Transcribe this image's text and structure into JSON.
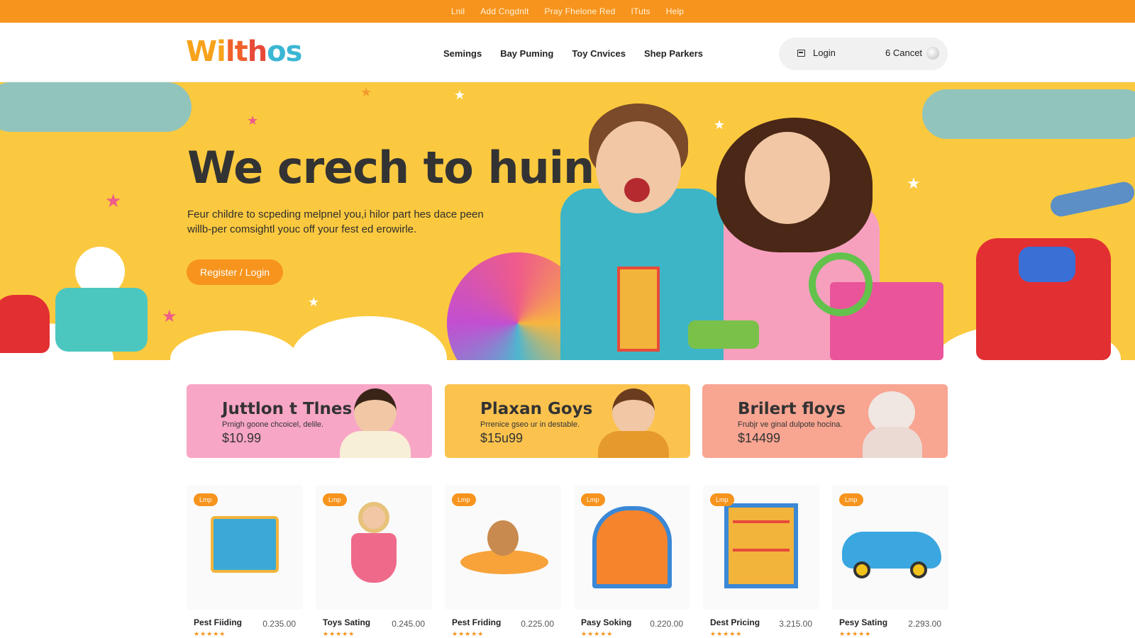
{
  "topbar": {
    "links": [
      "Lnil",
      "Add Cngdnlt",
      "Pray Fhelone Red",
      "ITuts",
      "Help"
    ]
  },
  "header": {
    "logo_text": "Wilthos",
    "nav": [
      "Semings",
      "Bay Puming",
      "Toy Cnvices",
      "Shep Parkers"
    ],
    "login_label": "Login",
    "cart_label": "6 Cancet"
  },
  "hero": {
    "title": "We crech to huin!",
    "subtitle": "Feur childre to scpeding melpnel you,i hilor part hes dace peen willb-per comsightl youc off your fest ed erowirle.",
    "cta_label": "Register / Login"
  },
  "promos": [
    {
      "title": "Juttlon t Tlnes",
      "desc": "Prnigh goone chcoicel, delile.",
      "price": "$10.99",
      "color": "#f8a6c6"
    },
    {
      "title": "Plaxan Goys",
      "desc": "Prrenice gseo ur in destable.",
      "price": "$15u99",
      "color": "#fbc34e"
    },
    {
      "title": "Brilert floys",
      "desc": "Frubjr ve ginal dulpote hocina.",
      "price": "$14499",
      "color": "#f8a592"
    }
  ],
  "products": [
    {
      "badge": "Lmp",
      "name": "Pest Fiiding",
      "price": "0.235.00",
      "icon": "toy-house-icon"
    },
    {
      "badge": "Lmp",
      "name": "Toys Sating",
      "price": "0.245.00",
      "icon": "doll-icon"
    },
    {
      "badge": "Lmp",
      "name": "Pest Friding",
      "price": "0.225.00",
      "icon": "bear-icon"
    },
    {
      "badge": "Lmp",
      "name": "Pasy Soking",
      "price": "0.220.00",
      "icon": "playhouse-icon"
    },
    {
      "badge": "Lmp",
      "name": "Dest Pricing",
      "price": "3.215.00",
      "icon": "bookshelf-icon"
    },
    {
      "badge": "Lmp",
      "name": "Pesy Sating",
      "price": "2.293.00",
      "icon": "car-icon"
    }
  ],
  "colors": {
    "accent": "#f7941d",
    "hero_bg": "#fbc93f"
  }
}
